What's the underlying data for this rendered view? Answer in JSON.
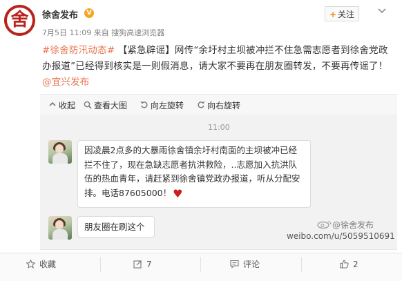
{
  "author": {
    "avatar_glyph": "舍",
    "name": "徐舍发布",
    "verified_badge": "V",
    "follow_label": "关注",
    "follow_plus": "+"
  },
  "meta": {
    "datetime": "7月5日 11:09",
    "source_prefix": "来自",
    "source": "搜狗高速浏览器"
  },
  "post": {
    "topic": "#徐舍防汛动态#",
    "body": "【紧急辟谣】网传“余圩村主坝被冲拦不住急需志愿者到徐舍党政办报道”已经得到核实是一则假消息，请大家不要再在朋友圈转发，不要再传谣了！",
    "mention": "@宜兴发布"
  },
  "toolbar": {
    "collapse": "收起",
    "view_large": "查看大图",
    "rotate_left": "向左旋转",
    "rotate_right": "向右旋转"
  },
  "image": {
    "time": "11:00",
    "message1": "因凌晨2点多的大暴雨徐舍镇余圩村南面的主坝被冲已经拦不住了，现在急缺志愿者抗洪救险，..志愿加入抗洪队伍的热血青年，请赶紧到徐舍镇党政办报道，听从分配安排。电话87605000！",
    "heart": "♥",
    "message2": "朋友圈在刷这个",
    "watermark_weibo": "@徐舍发布",
    "watermark_url": "weibo.com/u/5059510691"
  },
  "footer": {
    "favorite": "收藏",
    "repost_count": "7",
    "comment": "评论",
    "like_count": "2"
  },
  "colors": {
    "accent_orange": "#eb7350",
    "avatar_red": "#b8231c",
    "verified": "#f5a623"
  }
}
